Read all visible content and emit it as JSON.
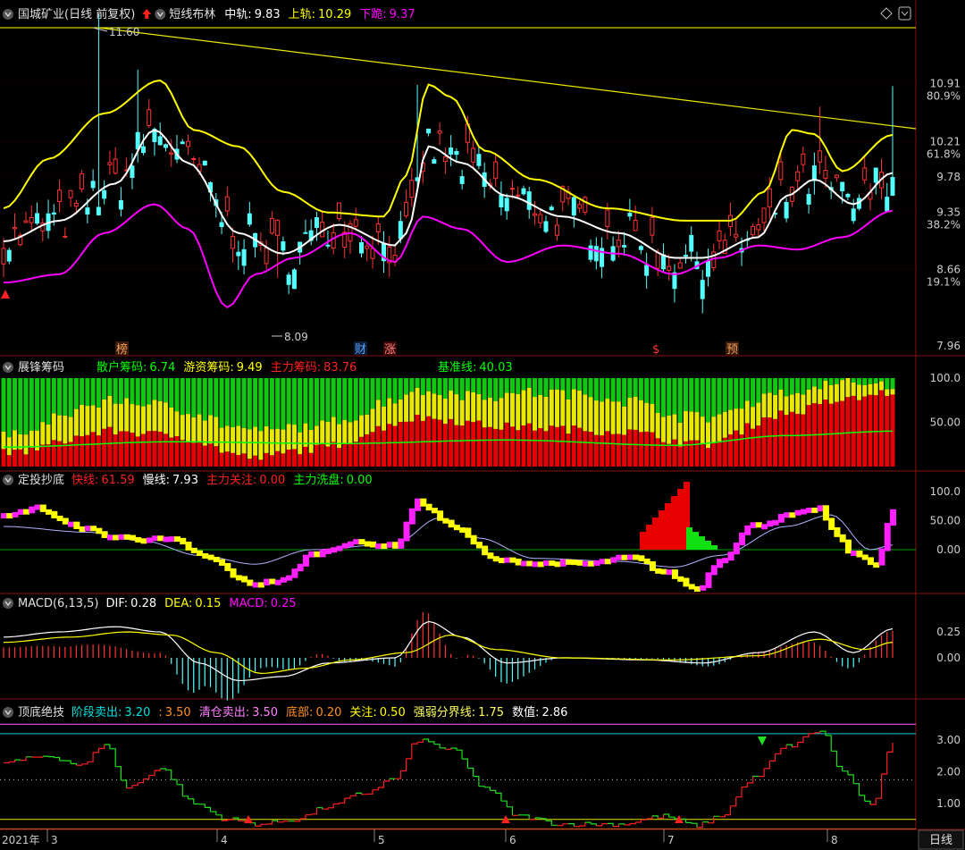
{
  "panels": [
    {
      "id": "price",
      "title": "国城矿业(日线 前复权)",
      "indicator": "短线布林",
      "legend": [
        {
          "label": "中轨:",
          "value": "9.83",
          "color": "#ffffff"
        },
        {
          "label": "上轨:",
          "value": "10.29",
          "color": "#ffff00"
        },
        {
          "label": "下跪:",
          "value": "9.37",
          "color": "#ff00ff"
        }
      ],
      "axis_labels": [
        "10.91",
        "80.9%",
        "10.21",
        "61.8%",
        "9.78",
        "9.35",
        "38.2%",
        "8.66",
        "19.1%",
        "7.96"
      ],
      "annotations": [
        "11.60",
        "8.09"
      ],
      "markers": [
        "榜",
        "财",
        "涨",
        "$",
        "预"
      ]
    },
    {
      "id": "chips",
      "title": "展锋筹码",
      "legend": [
        {
          "label": "散户筹码:",
          "value": "6.74",
          "color": "#00ff00"
        },
        {
          "label": "游资筹码:",
          "value": "9.49",
          "color": "#ffff00"
        },
        {
          "label": "主力筹码:",
          "value": "83.76",
          "color": "#ff2020"
        },
        {
          "label": "基准线:",
          "value": "40.03",
          "color": "#00ff00"
        }
      ],
      "axis_labels": [
        "100.0",
        "50.00"
      ]
    },
    {
      "id": "dingtou",
      "title": "定投抄底",
      "legend": [
        {
          "label": "快线:",
          "value": "61.59",
          "color": "#ff2020"
        },
        {
          "label": "慢线:",
          "value": "7.93",
          "color": "#ffffff"
        },
        {
          "label": "主力关注:",
          "value": "0.00",
          "color": "#ff2020"
        },
        {
          "label": "主力洗盘:",
          "value": "0.00",
          "color": "#00ff00"
        }
      ],
      "axis_labels": [
        "100.0",
        "50.00",
        "0.00"
      ]
    },
    {
      "id": "macd",
      "title": "MACD(6,13,5)",
      "legend": [
        {
          "label": "DIF:",
          "value": "0.28",
          "color": "#ffffff"
        },
        {
          "label": "DEA:",
          "value": "0.15",
          "color": "#ffff00"
        },
        {
          "label": "MACD:",
          "value": "0.25",
          "color": "#ff00ff"
        }
      ],
      "axis_labels": [
        "0.25",
        "0.00"
      ]
    },
    {
      "id": "dingdi",
      "title": "顶底绝技",
      "legend": [
        {
          "label": "阶段卖出:",
          "value": "3.20",
          "color": "#00e0e0"
        },
        {
          "label": ":",
          "value": "3.50",
          "color": "#ff9020"
        },
        {
          "label": "清仓卖出:",
          "value": "3.50",
          "color": "#ff80ff"
        },
        {
          "label": "底部:",
          "value": "0.20",
          "color": "#ff9020"
        },
        {
          "label": "关注:",
          "value": "0.50",
          "color": "#ffff00"
        },
        {
          "label": "强弱分界线:",
          "value": "1.75",
          "color": "#ffff60"
        },
        {
          "label": "数值:",
          "value": "2.86",
          "color": "#ffffff"
        }
      ],
      "axis_labels": [
        "3.00",
        "2.00",
        "1.00"
      ]
    }
  ],
  "time_axis": {
    "labels": [
      "2021年",
      "3",
      "4",
      "5",
      "6",
      "7",
      "8"
    ],
    "period_button": "日线"
  },
  "chart_data": {
    "type": "candlestick",
    "title": "国城矿业(日线 前复权)",
    "price_range": [
      7.96,
      11.6
    ],
    "last_values": {
      "mid": 9.83,
      "upper": 10.29,
      "lower": 9.37
    },
    "high": 11.6,
    "low": 8.09,
    "colors": {
      "up": "#ff3232",
      "down": "#54ffff",
      "mid": "#ffffff",
      "upper": "#ffff00",
      "lower": "#ff00ff"
    }
  }
}
